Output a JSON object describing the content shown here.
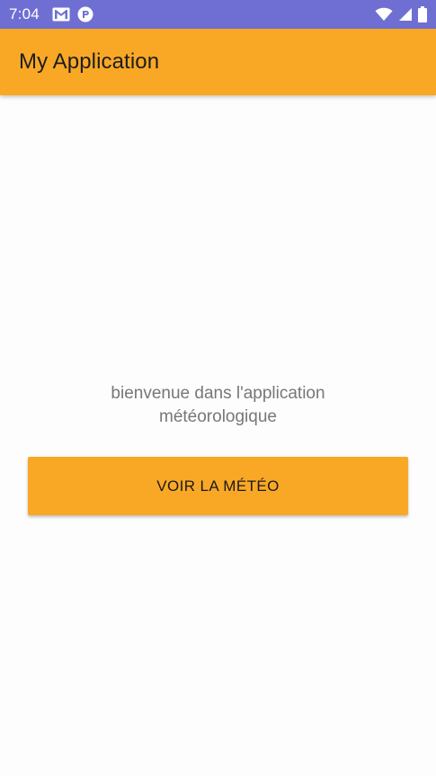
{
  "status_bar": {
    "time": "7:04",
    "left_icons": [
      "gmail-icon",
      "notification-app-icon"
    ],
    "right_icons": [
      "wifi-icon",
      "signal-icon",
      "battery-icon"
    ],
    "background_color": "#6f6fd3"
  },
  "app_bar": {
    "title": "My Application",
    "background_color": "#f9a826"
  },
  "main": {
    "welcome_line_1": "bienvenue dans l'application",
    "welcome_line_2": "météorologique",
    "button_label": "VOIR LA MÉTÉO",
    "button_color": "#f9a826"
  }
}
